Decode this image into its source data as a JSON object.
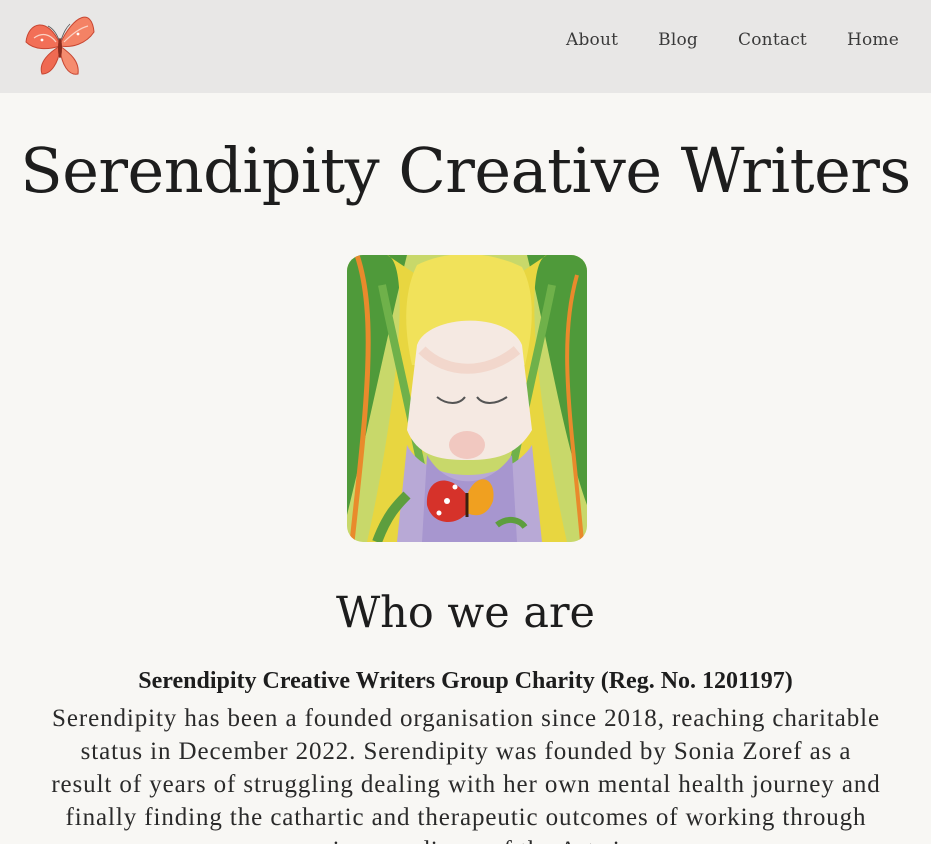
{
  "nav": {
    "logo_icon": "butterfly-icon",
    "items": [
      {
        "label": "About"
      },
      {
        "label": "Blog"
      },
      {
        "label": "Contact"
      },
      {
        "label": "Home"
      }
    ]
  },
  "site": {
    "title": "Serendipity Creative Writers"
  },
  "hero": {
    "image_icon": "painting-girl-butterfly-icon"
  },
  "who_we_are": {
    "heading": "Who we are",
    "charity_line": "Serendipity Creative Writers Group Charity (Reg. No. 1201197)",
    "paragraph": "Serendipity has been a founded organisation since 2018, reaching charitable status in December 2022. Serendipity was founded by Sonia Zoref as a result of years of struggling dealing with her own mental health journey and finally finding the cathartic and therapeutic outcomes of working through various mediums of the Arts in"
  },
  "colors": {
    "header_bg": "#e8e7e6",
    "page_bg": "#f8f7f4",
    "text": "#1d1d1d"
  }
}
